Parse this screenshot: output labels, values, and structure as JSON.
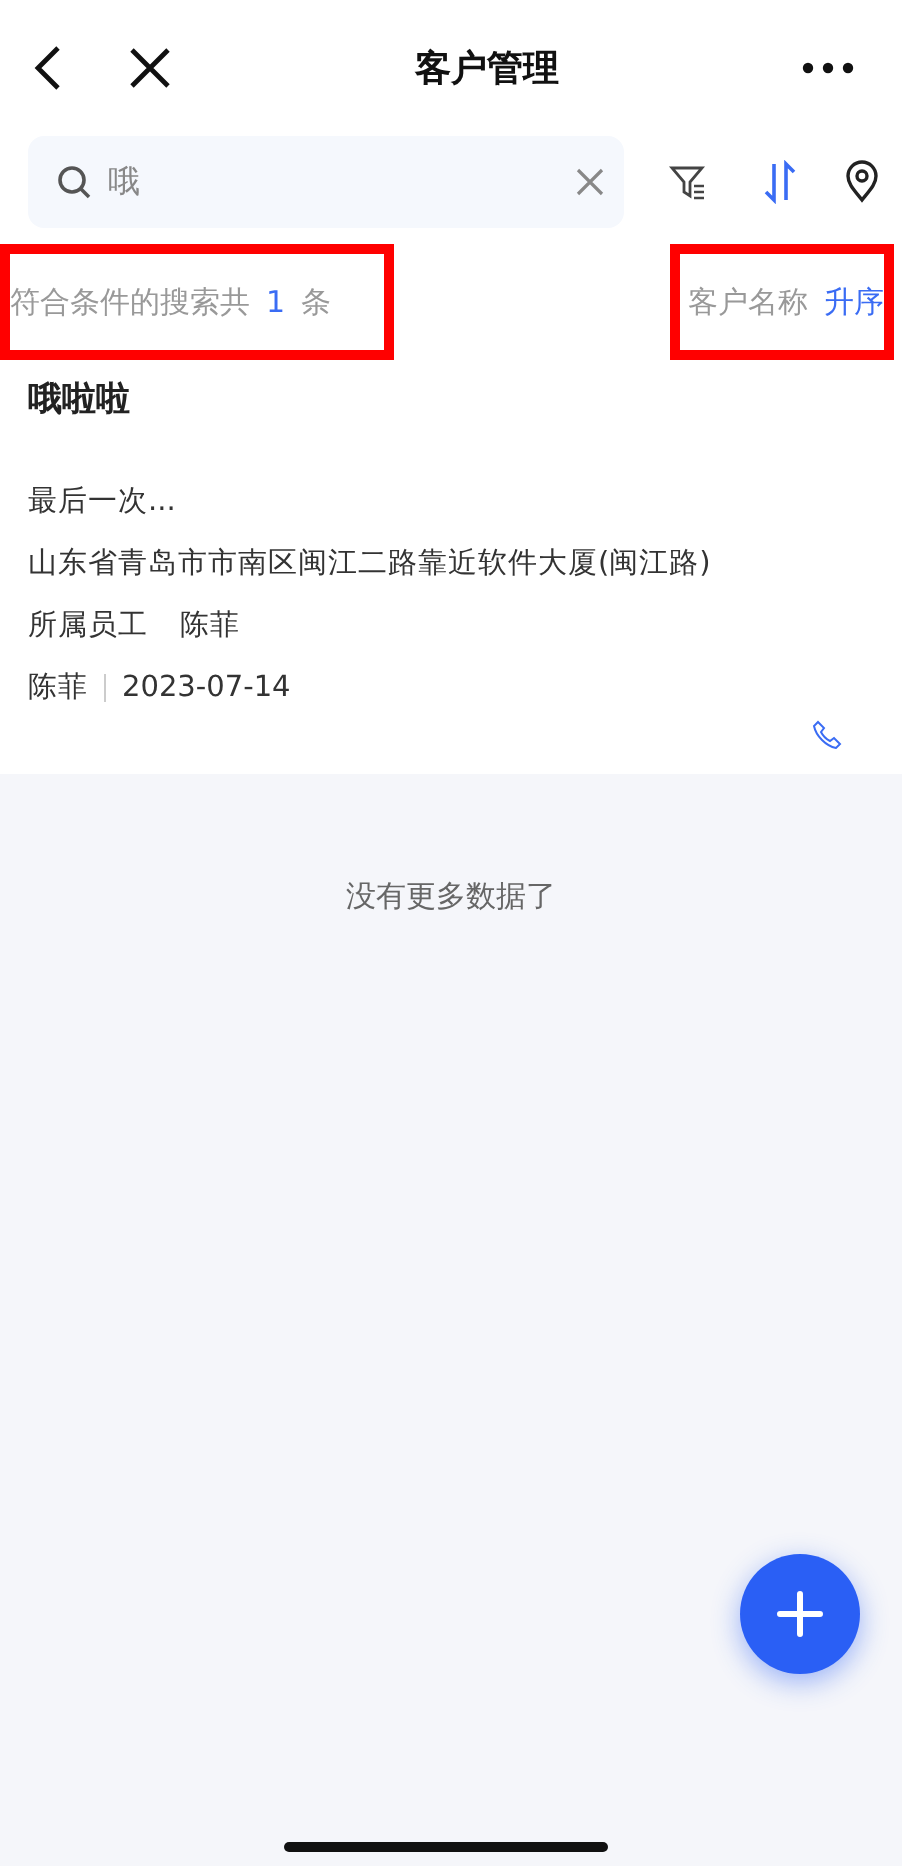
{
  "header": {
    "title": "客户管理"
  },
  "search": {
    "value": "哦"
  },
  "toolbar": {
    "sort_active": true
  },
  "summary": {
    "prefix": "符合条件的搜索共",
    "count": "1",
    "suffix": "条",
    "highlighted": true
  },
  "sort": {
    "field": "客户名称",
    "order": "升序",
    "highlighted": true
  },
  "customers": [
    {
      "name": "哦啦啦",
      "last_follow": "最后一次...",
      "address": "山东省青岛市市南区闽江二路靠近软件大厦(闽江路)",
      "owner_label": "所属员工",
      "owner": "陈菲",
      "creator": "陈菲",
      "date": "2023-07-14"
    }
  ],
  "end_note": "没有更多数据了"
}
